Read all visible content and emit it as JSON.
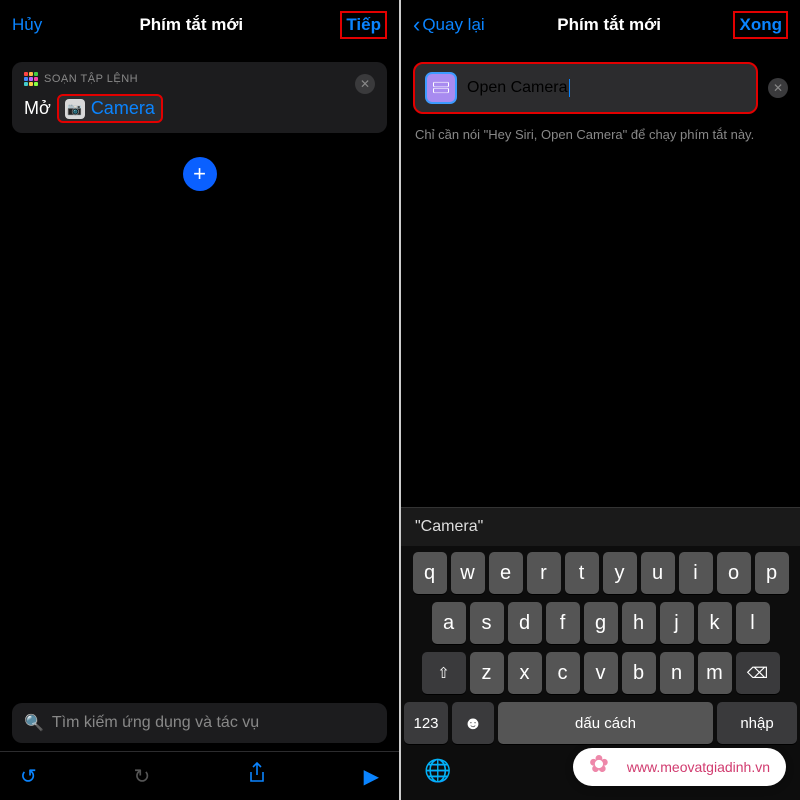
{
  "left": {
    "header": {
      "cancel": "Hủy",
      "title": "Phím tắt mới",
      "next": "Tiếp"
    },
    "card": {
      "label": "SOẠN TẬP LỆNH",
      "open": "Mở",
      "app": "Camera"
    },
    "search_placeholder": "Tìm kiếm ứng dụng và tác vụ"
  },
  "right": {
    "header": {
      "back": "Quay lại",
      "title": "Phím tắt mới",
      "done": "Xong"
    },
    "name": "Open Camera",
    "hint": "Chỉ cần nói \"Hey Siri, Open Camera\" để chạy phím tắt này.",
    "suggestion": "\"Camera\"",
    "keyboard": {
      "row1": [
        "q",
        "w",
        "e",
        "r",
        "t",
        "y",
        "u",
        "i",
        "o",
        "p"
      ],
      "row2": [
        "a",
        "s",
        "d",
        "f",
        "g",
        "h",
        "j",
        "k",
        "l"
      ],
      "row3": [
        "z",
        "x",
        "c",
        "v",
        "b",
        "n",
        "m"
      ],
      "k123": "123",
      "space": "dấu cách",
      "return": "nhập"
    }
  },
  "watermark": "www.meovatgiadinh.vn"
}
